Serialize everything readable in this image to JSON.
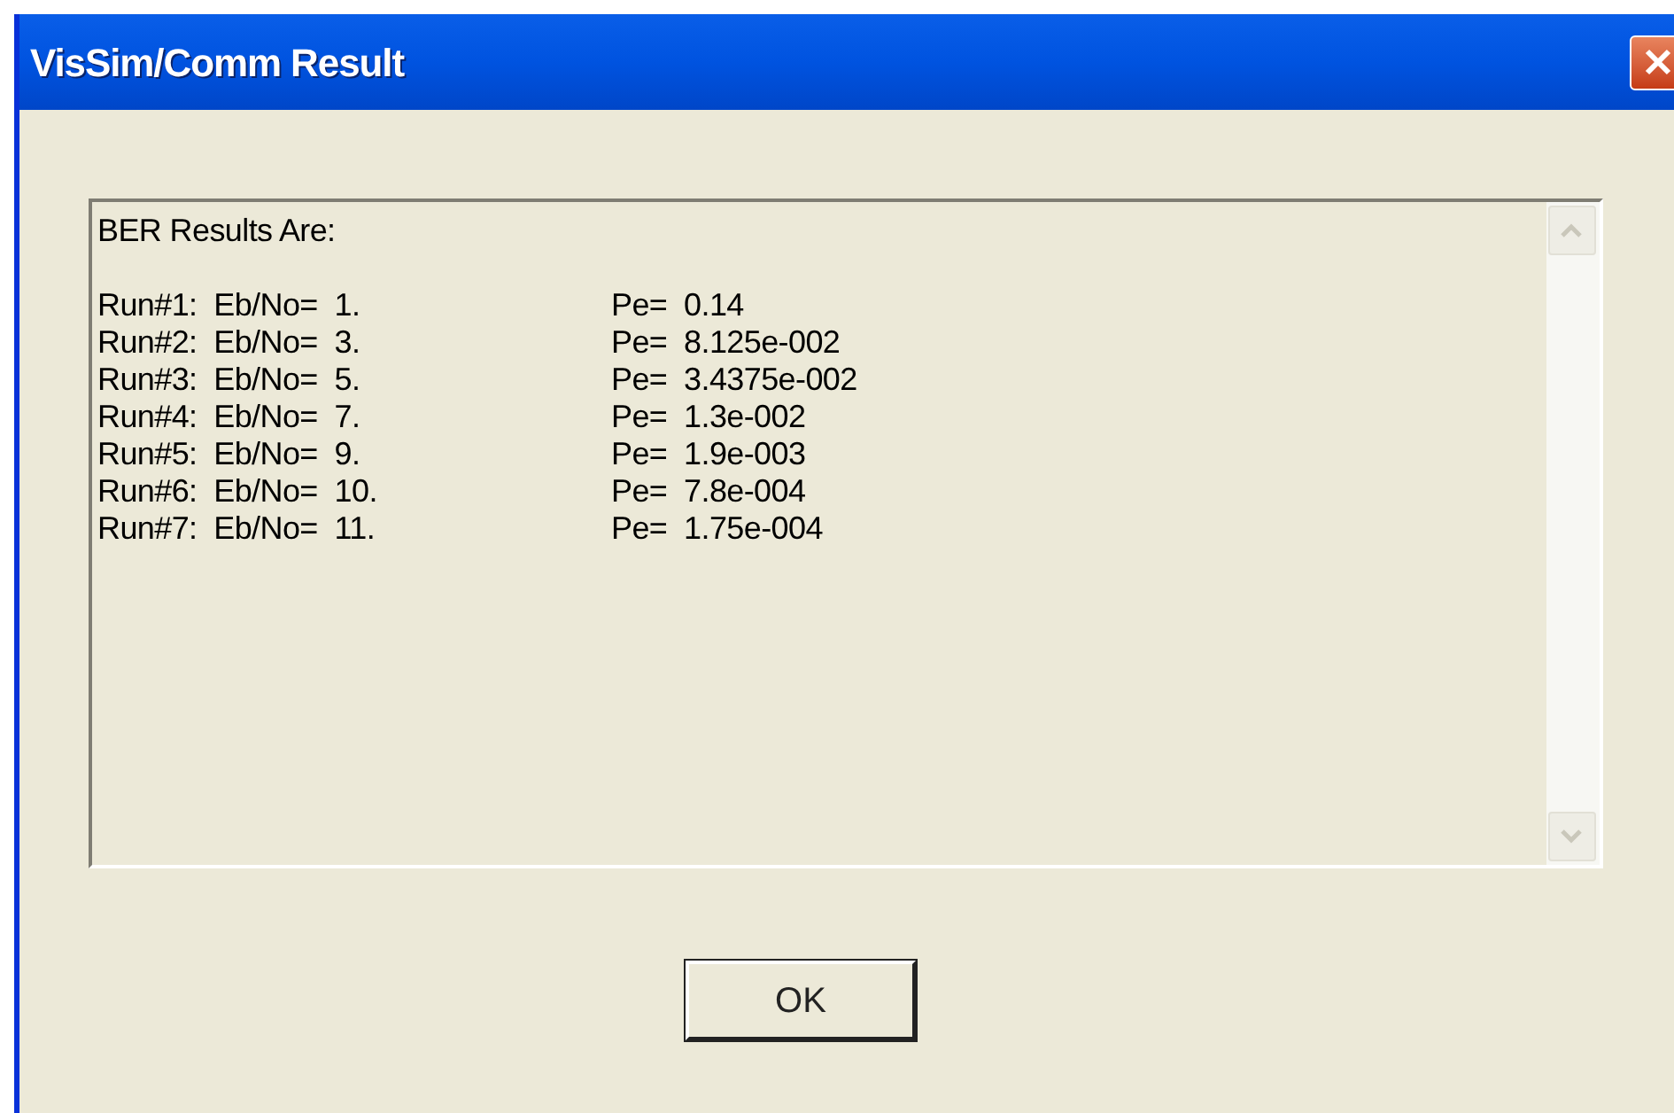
{
  "window": {
    "title": "VisSim/Comm Result"
  },
  "results": {
    "heading": "BER Results Are:",
    "rows": [
      {
        "run": "Run#1:  Eb/No=  1.",
        "pe": "Pe=  0.14"
      },
      {
        "run": "Run#2:  Eb/No=  3.",
        "pe": "Pe=  8.125e-002"
      },
      {
        "run": "Run#3:  Eb/No=  5.",
        "pe": "Pe=  3.4375e-002"
      },
      {
        "run": "Run#4:  Eb/No=  7.",
        "pe": "Pe=  1.3e-002"
      },
      {
        "run": "Run#5:  Eb/No=  9.",
        "pe": "Pe=  1.9e-003"
      },
      {
        "run": "Run#6:  Eb/No=  10.",
        "pe": "Pe=  7.8e-004"
      },
      {
        "run": "Run#7:  Eb/No=  11.",
        "pe": "Pe=  1.75e-004"
      }
    ]
  },
  "buttons": [
    "OK"
  ]
}
